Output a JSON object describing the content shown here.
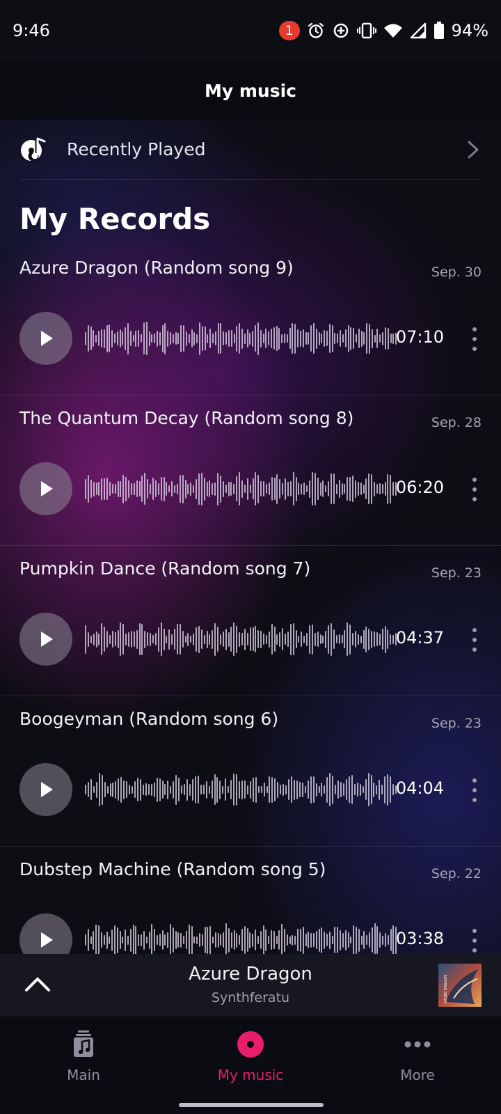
{
  "status_bar": {
    "time": "9:46",
    "notification_count": "1",
    "battery": "94%",
    "icons": [
      "alarm-icon",
      "data-saver-icon",
      "vibrate-icon",
      "wifi-icon",
      "signal-icon",
      "battery-icon"
    ]
  },
  "header": {
    "title": "My music"
  },
  "recently_played": {
    "label": "Recently Played"
  },
  "section": {
    "title": "My Records"
  },
  "records": [
    {
      "title": "Azure Dragon (Random song 9)",
      "date": "Sep. 30",
      "duration": "07:10"
    },
    {
      "title": "The Quantum Decay (Random song 8)",
      "date": "Sep. 28",
      "duration": "06:20"
    },
    {
      "title": "Pumpkin Dance (Random song 7)",
      "date": "Sep. 23",
      "duration": "04:37"
    },
    {
      "title": "Boogeyman (Random song 6)",
      "date": "Sep. 23",
      "duration": "04:04"
    },
    {
      "title": "Dubstep Machine (Random song 5)",
      "date": "Sep. 22",
      "duration": "03:38"
    }
  ],
  "mini_player": {
    "title": "Azure Dragon",
    "artist": "Synthferatu",
    "album_art_text": "AZURE DRAGON"
  },
  "bottom_nav": [
    {
      "label": "Main",
      "icon": "music-note-icon",
      "active": false
    },
    {
      "label": "My music",
      "icon": "record-icon",
      "active": true
    },
    {
      "label": "More",
      "icon": "more-horizontal-icon",
      "active": false
    }
  ],
  "colors": {
    "accent": "#e91e6b",
    "background": "#0d0d14",
    "badge": "#e63b2e"
  }
}
